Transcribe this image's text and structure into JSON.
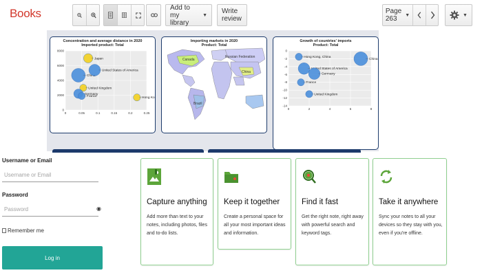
{
  "toolbar": {
    "logo": "Books",
    "add_library_label": "Add to my library",
    "write_review_label": "Write review",
    "page_label": "Page 263",
    "zoom_out": "zoom-out-icon",
    "zoom_in": "zoom-in-icon"
  },
  "figures": {
    "scatter_left": {
      "title": "Concentration and average distance in 2020",
      "subtitle": "Imported product: Total"
    },
    "map": {
      "title": "Importing markets in 2020",
      "subtitle": "Product: Total"
    },
    "scatter_right": {
      "title": "Growth of countries' imports",
      "subtitle": "Product: Total"
    }
  },
  "chart_data": [
    {
      "type": "scatter",
      "title": "Concentration and average distance in 2020",
      "subtitle": "Imported product: Total",
      "xlim": [
        0,
        0.25
      ],
      "ylim": [
        0,
        8000
      ],
      "x_ticks": [
        "0",
        "0.05",
        "0.1",
        "0.15",
        "0.2",
        "0.25"
      ],
      "y_ticks": [
        "0",
        "2000",
        "4000",
        "6000",
        "8000"
      ],
      "points": [
        {
          "label": "Japan",
          "x": 0.07,
          "y": 7000,
          "size": 3,
          "color": "#f3d020"
        },
        {
          "label": "China",
          "x": 0.04,
          "y": 4700,
          "size": 5,
          "color": "#4a8fdc"
        },
        {
          "label": "United States of America",
          "x": 0.09,
          "y": 5400,
          "size": 4,
          "color": "#4a8fdc"
        },
        {
          "label": "United Kingdom",
          "x": 0.055,
          "y": 3000,
          "size": 2,
          "color": "#f3d020"
        },
        {
          "label": "Hong Kong, China",
          "x": 0.22,
          "y": 1700,
          "size": 2,
          "color": "#f3d020"
        },
        {
          "label": "Germany",
          "x": 0.04,
          "y": 2200,
          "size": 3,
          "color": "#4a8fdc"
        },
        {
          "label": "France",
          "x": 0.05,
          "y": 1900,
          "size": 2,
          "color": "#4a8fdc"
        }
      ]
    },
    {
      "type": "map",
      "title": "Importing markets in 2020",
      "subtitle": "Product: Total",
      "labels": [
        "Canada",
        "Russian Federation",
        "China",
        "Brazil"
      ]
    },
    {
      "type": "scatter",
      "title": "Growth of countries' imports",
      "subtitle": "Product: Total",
      "xlim": [
        0,
        8
      ],
      "ylim": [
        -14,
        0
      ],
      "x_ticks": [
        "0",
        "2",
        "4",
        "6",
        "8"
      ],
      "y_ticks": [
        "0",
        "-2",
        "-4",
        "-6",
        "-8",
        "-10",
        "-12",
        "-14"
      ],
      "points": [
        {
          "label": "Hong Kong, China",
          "x": 1,
          "y": -1.5,
          "size": 2
        },
        {
          "label": "United States of America",
          "x": 1.5,
          "y": -4.5,
          "size": 4
        },
        {
          "label": "Germany",
          "x": 2.5,
          "y": -5.8,
          "size": 4
        },
        {
          "label": "China",
          "x": 7,
          "y": -2,
          "size": 5
        },
        {
          "label": "France",
          "x": 1.2,
          "y": -8,
          "size": 2
        },
        {
          "label": "United Kingdom",
          "x": 2,
          "y": -11,
          "size": 2
        }
      ]
    }
  ],
  "login": {
    "username_label": "Username or Email",
    "username_placeholder": "Username or Email",
    "password_label": "Password",
    "password_placeholder": "Password",
    "remember_label": "Remember me",
    "login_button": "Log in"
  },
  "features": [
    {
      "title": "Capture anything",
      "desc": "Add more than text to your notes, including photos, files and to-do lists.",
      "icon": "capture-icon"
    },
    {
      "title": "Keep it together",
      "desc": "Create a personal space for all your most important ideas and information.",
      "icon": "folder-icon"
    },
    {
      "title": "Find it fast",
      "desc": "Get the right note, right away with powerful search and keyword tags.",
      "icon": "search-icon"
    },
    {
      "title": "Take it anywhere",
      "desc": "Sync your notes to all your devices so they stay with you, even if you're offline.",
      "icon": "sync-icon"
    }
  ],
  "colors": {
    "logo": "#d2382c",
    "login_button": "#22a596",
    "accent_green": "#5ca53a",
    "card_border": "#1c3a6b",
    "bubble_blue": "#4a8fdc",
    "bubble_yellow": "#f3d020"
  }
}
